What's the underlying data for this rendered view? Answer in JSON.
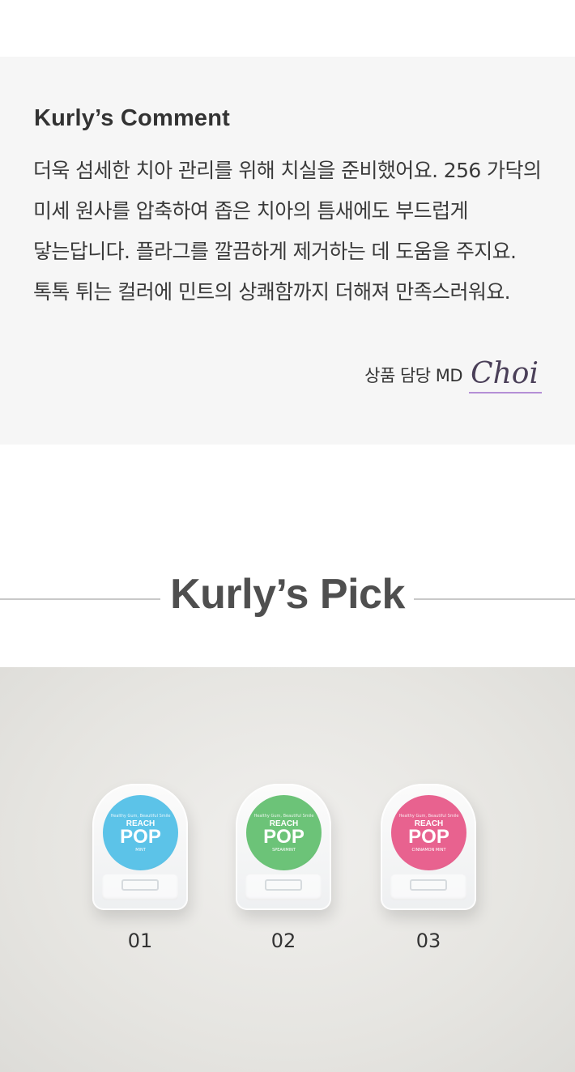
{
  "comment": {
    "title": "Kurly’s Comment",
    "body": "더욱 섬세한 치아 관리를 위해 치실을 준비했어요. 256 가닥의 미세 원사를 압축하여 좁은 치아의 틈새에도 부드럽게 닿는답니다. 플라그를 깔끔하게 제거하는 데 도움을 주지요. 톡톡 튀는 컬러에 민트의 상쾌함까지 더해져 만족스러워요.",
    "md_label": "상품 담당 MD",
    "md_signature": "Choi"
  },
  "pick": {
    "title": "Kurly’s Pick"
  },
  "products": [
    {
      "number": "01",
      "brand": "REACH",
      "name": "POP",
      "flavor": "MINT",
      "tagline": "Healthy Gum, Beautiful Smile",
      "color": "#5cc3e8"
    },
    {
      "number": "02",
      "brand": "REACH",
      "name": "POP",
      "flavor": "SPEARMINT",
      "tagline": "Healthy Gum, Beautiful Smile",
      "color": "#6cc378"
    },
    {
      "number": "03",
      "brand": "REACH",
      "name": "POP",
      "flavor": "CINNAMON MINT",
      "tagline": "Healthy Gum, Beautiful Smile",
      "color": "#e8628f"
    }
  ],
  "colors": {
    "comment_bg": "#f6f6f6",
    "signature_underline": "#b48fd6",
    "pick_title": "#4f4f4f"
  }
}
